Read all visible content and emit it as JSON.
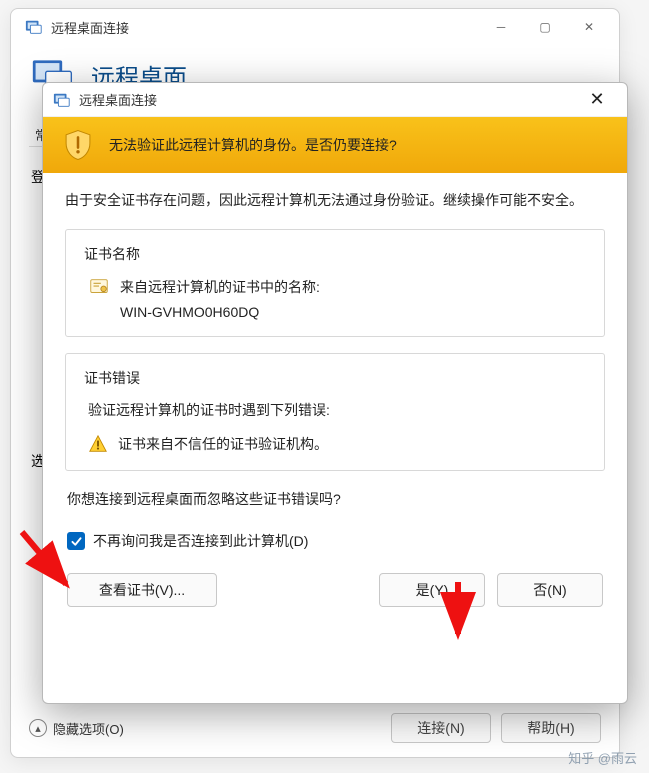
{
  "parent": {
    "title": "远程桌面连接",
    "big_title": "远程桌面",
    "tab_general": "常",
    "login_label": "登",
    "other_label": "选",
    "hide_options": "隐藏选项(O)",
    "connect_btn": "连接(N)",
    "help_btn": "帮助(H)"
  },
  "dialog": {
    "title": "远程桌面连接",
    "warning": "无法验证此远程计算机的身份。是否仍要连接?",
    "security_text": "由于安全证书存在问题，因此远程计算机无法通过身份验证。继续操作可能不安全。",
    "cert_name_legend": "证书名称",
    "cert_from_label": "来自远程计算机的证书中的名称:",
    "cert_cn": "WIN-GVHMO0H60DQ",
    "cert_error_legend": "证书错误",
    "cert_error_intro": "验证远程计算机的证书时遇到下列错误:",
    "cert_error_item": "证书来自不信任的证书验证机构。",
    "question": "你想连接到远程桌面而忽略这些证书错误吗?",
    "checkbox_label": "不再询问我是否连接到此计算机(D)",
    "checkbox_checked": true,
    "view_cert_btn": "查看证书(V)...",
    "yes_btn": "是(Y)",
    "no_btn": "否(N)"
  },
  "watermark": "知乎 @雨云"
}
